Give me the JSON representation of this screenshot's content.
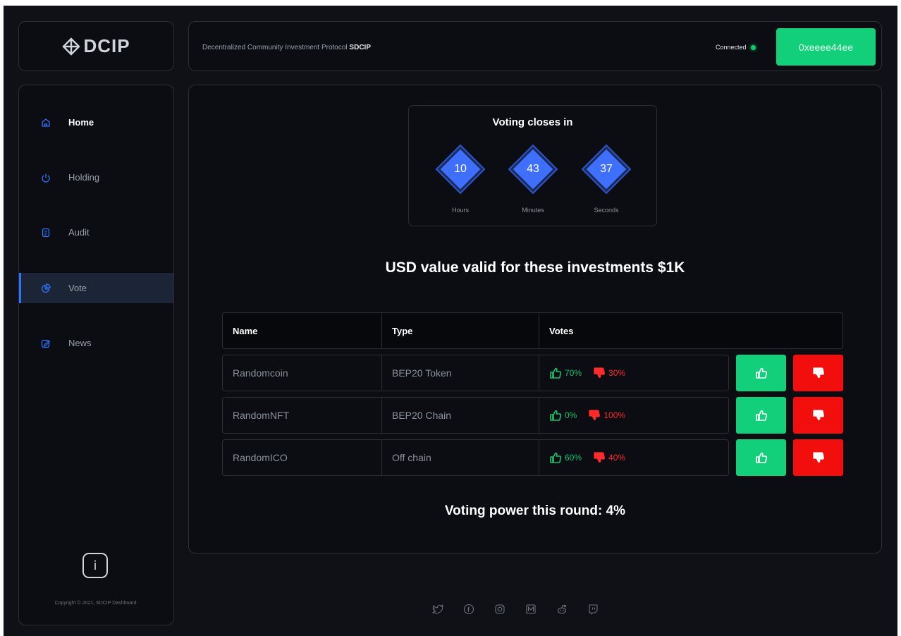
{
  "brand": {
    "logo_text": "DCIP"
  },
  "header": {
    "protocol_prefix": "Decentralized Community Investment Protocol ",
    "protocol_name": "SDCIP",
    "connection_status": "Connected",
    "wallet_address": "0xeeee44ee"
  },
  "sidebar": {
    "items": [
      {
        "label": "Home",
        "icon": "home-icon"
      },
      {
        "label": "Holding",
        "icon": "power-icon"
      },
      {
        "label": "Audit",
        "icon": "document-icon"
      },
      {
        "label": "Vote",
        "icon": "pie-chart-icon"
      },
      {
        "label": "News",
        "icon": "edit-icon"
      }
    ],
    "active": "Vote",
    "info_glyph": "i",
    "copyright": "Copyright © 2021, SDCIP Dashboard."
  },
  "timer": {
    "title": "Voting closes in",
    "units": [
      {
        "value": "10",
        "label": "Hours"
      },
      {
        "value": "43",
        "label": "Minutes"
      },
      {
        "value": "37",
        "label": "Seconds"
      }
    ]
  },
  "usd_heading": "USD value valid for these investments $1K",
  "table": {
    "columns": [
      "Name",
      "Type",
      "Votes"
    ],
    "rows": [
      {
        "name": "Randomcoin",
        "type": "BEP20 Token",
        "up": "70%",
        "down": "30%"
      },
      {
        "name": "RandomNFT",
        "type": "BEP20 Chain",
        "up": "0%",
        "down": "100%"
      },
      {
        "name": "RandomICO",
        "type": "Off chain",
        "up": "60%",
        "down": "40%"
      }
    ]
  },
  "voting_power": "Voting power this round: 4%",
  "colors": {
    "accent_green": "#12cf7a",
    "accent_red": "#f30e0e",
    "accent_blue": "#3f6fff",
    "background": "#0f1117"
  },
  "footer_icons": [
    "twitter-icon",
    "facebook-icon",
    "instagram-icon",
    "medium-icon",
    "reddit-icon",
    "twitch-icon"
  ]
}
